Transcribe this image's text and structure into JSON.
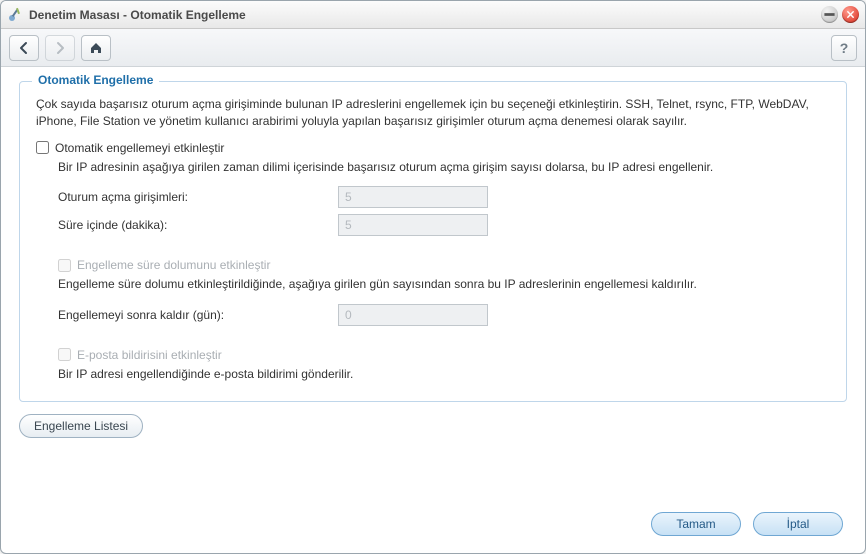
{
  "window": {
    "title": "Denetim Masası - Otomatik Engelleme"
  },
  "toolbar": {
    "help_glyph": "?"
  },
  "fieldset": {
    "legend": "Otomatik Engelleme",
    "description": "Çok sayıda başarısız oturum açma girişiminde bulunan IP adreslerini engellemek için bu seçeneği etkinleştirin. SSH, Telnet, rsync, FTP, WebDAV, iPhone, File Station ve yönetim kullanıcı arabirimi yoluyla yapılan başarısız girişimler oturum açma denemesi olarak sayılır.",
    "enable_label": "Otomatik engellemeyi etkinleştir",
    "enable_desc": "Bir IP adresinin aşağıya girilen zaman dilimi içerisinde başarısız oturum açma girişim sayısı dolarsa, bu IP adresi engellenir.",
    "attempts_label": "Oturum açma girişimleri:",
    "attempts_value": "5",
    "within_label": "Süre içinde (dakika):",
    "within_value": "5",
    "expire_enable_label": "Engelleme süre dolumunu etkinleştir",
    "expire_desc": "Engelleme süre dolumu etkinleştirildiğinde, aşağıya girilen gün sayısından sonra bu IP adreslerinin engellemesi kaldırılır.",
    "expire_days_label": "Engellemeyi sonra kaldır (gün):",
    "expire_days_value": "0",
    "email_enable_label": "E-posta bildirisini etkinleştir",
    "email_desc": "Bir IP adresi engellendiğinde e-posta bildirimi gönderilir."
  },
  "buttons": {
    "block_list": "Engelleme Listesi",
    "ok": "Tamam",
    "cancel": "İptal"
  }
}
